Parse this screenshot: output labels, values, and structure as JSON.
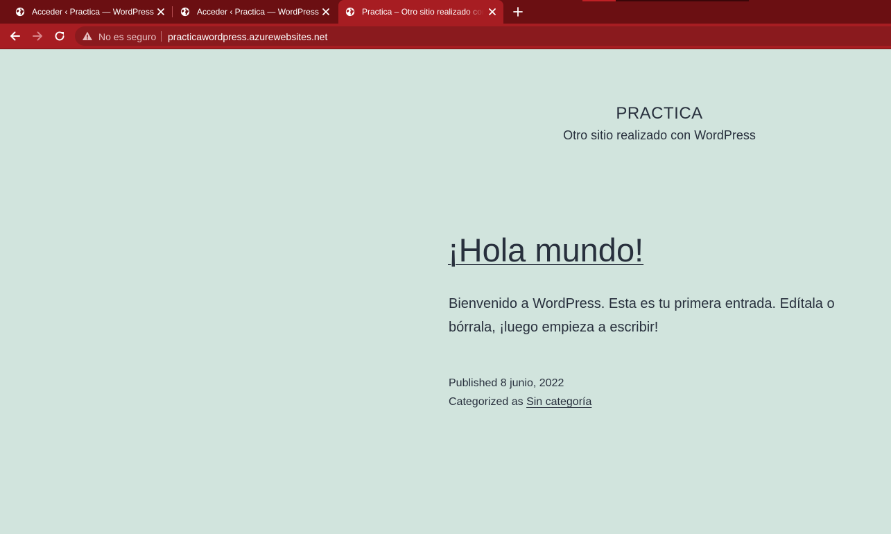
{
  "browser": {
    "tabs": [
      {
        "title": "Acceder ‹ Practica — WordPress",
        "active": false
      },
      {
        "title": "Acceder ‹ Practica — WordPress",
        "active": false
      },
      {
        "title": "Practica – Otro sitio realizado con WordPress",
        "active": true
      }
    ],
    "security_label": "No es seguro",
    "url": "practicawordpress.azurewebsites.net",
    "colors": {
      "frame": "#6b0f12",
      "toolbar": "#a71d22",
      "omnibox": "#8a1a1e"
    }
  },
  "site": {
    "title": "PRACTICA",
    "tagline": "Otro sitio realizado con WordPress",
    "background": "#d1e4dd",
    "text_color": "#28303d"
  },
  "post": {
    "title": "¡Hola mundo!",
    "excerpt": "Bienvenido a WordPress. Esta es tu primera entrada. Edítala o bórrala, ¡luego empieza a escribir!",
    "published_label": "Published",
    "published_date": "8 junio, 2022",
    "categorized_label": "Categorized as",
    "category": "Sin categoría"
  },
  "icons": {
    "tab_favicon": "globe-icon",
    "tab_close": "close-icon",
    "new_tab": "plus-icon",
    "back": "arrow-left-icon",
    "forward": "arrow-right-icon",
    "reload": "reload-icon",
    "security": "warning-triangle-icon"
  }
}
